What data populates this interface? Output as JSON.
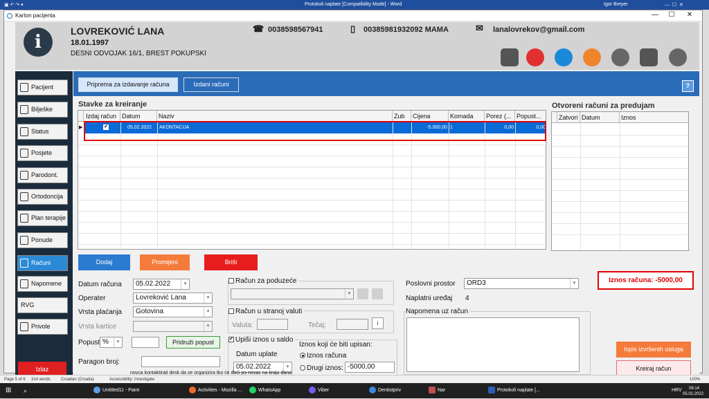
{
  "word": {
    "title": "Protokoli naplate [Compatibility Mode] - Word",
    "user": "Igor Breyer",
    "status_page": "Page 5 of 6",
    "status_words": "314 words",
    "status_lang": "Croatian (Croatia)",
    "status_access": "Accessibility: Investigate",
    "zoom": "100%",
    "doc_text": "novca kontaktirati desk da se organizira tko će doći po novac na kraju dana."
  },
  "window": {
    "title": "Karton pacijenta",
    "min": "—",
    "max": "☐",
    "close": "✕"
  },
  "header": {
    "icon": "i",
    "name": "LOVREKOVIĆ LANA",
    "dob": "18.01.1997",
    "address": "DESNI ODVOJAK 16/1, BREST POKUPSKI",
    "phone": "0038598567941",
    "mobile": "00385981932092 MAMA",
    "email": "lanalovrekov@gmail.com",
    "phone_icon": "☎",
    "mobile_icon": "▯",
    "email_icon": "✉"
  },
  "sidebar": {
    "items": [
      {
        "label": "Pacijent"
      },
      {
        "label": "Bilješke"
      },
      {
        "label": "Status"
      },
      {
        "label": "Posjete"
      },
      {
        "label": "Parodont."
      },
      {
        "label": "Ortodoncija"
      },
      {
        "label": "Plan terapije"
      },
      {
        "label": "Ponude"
      },
      {
        "label": "Računi"
      },
      {
        "label": "Napomene"
      },
      {
        "label": "RVG"
      },
      {
        "label": "Privole"
      }
    ],
    "exit": "Izlaz"
  },
  "tabs": {
    "prepare": "Priprema za izdavanje računa",
    "issued": "Izdani računi",
    "help": "?"
  },
  "items_grid": {
    "title": "Stavke za kreiranje",
    "columns": [
      "Izdaj račun",
      "Datum",
      "Naziv",
      "Zub",
      "Cijena",
      "Komada",
      "Porez (...",
      "Popust..."
    ],
    "row": {
      "check": "✔",
      "date": "05.02.2022",
      "name": "AKONTACIJA",
      "tooth": "",
      "price": "-5.000,00",
      "qty": "1",
      "tax": "0,00",
      "discount": "0,00"
    },
    "row_marker": "▶"
  },
  "open_grid": {
    "title": "Otvoreni računi za predujam",
    "columns": [
      "Zatvori",
      "Datum",
      "Iznos"
    ]
  },
  "actions": {
    "add": "Dodaj",
    "change": "Promijeni",
    "delete": "Briši"
  },
  "form": {
    "date_label": "Datum računa",
    "date_value": "05.02.2022",
    "operator_label": "Operater",
    "operator_value": "Lovreković Lana",
    "pay_label": "Vrsta plaćanja",
    "pay_value": "Gotovina",
    "card_label": "Vrsta kartice",
    "card_value": "",
    "discount_label": "Popust",
    "discount_unit": "%",
    "discount_value": "",
    "attach_discount": "Pridruži popust",
    "receipt_label": "Paragon broj:",
    "receipt_value": ""
  },
  "company": {
    "label": "Račun za poduzeće",
    "value": ""
  },
  "foreign": {
    "label": "Račun u stranoj valuti",
    "currency_label": "Valuta:",
    "rate_label": "Tečaj:",
    "info_btn": "i"
  },
  "balance": {
    "label": "Upiši iznos u saldo",
    "check": "✔",
    "payment_date_label": "Datum uplate",
    "payment_date": "05.02.2022",
    "amount_title": "Iznos koji će biti upisan:",
    "opt_invoice": "Iznos računa",
    "opt_other": "Drugi iznos:",
    "other_value": "-5000,00"
  },
  "business": {
    "space_label": "Poslovni prostor",
    "space_value": "ORD3",
    "device_label": "Naplatni uređaj",
    "device_value": "4"
  },
  "note": {
    "label": "Napomena uz račun",
    "value": ""
  },
  "total": {
    "text": "Iznos računa: -5000,00"
  },
  "buttons": {
    "print": "Ispis izvršenih usluga",
    "create": "Kreiraj račun"
  },
  "taskbar": {
    "apps": [
      "Untitled11 - Paint",
      "Activities - Mozilla ...",
      "WhatsApp",
      "Viber",
      "Dentistpriv",
      "Nar",
      "Protokoli naplate [..."
    ],
    "lang": "HRV",
    "time": "08:14",
    "date": "05.02.2022"
  },
  "colors": {
    "accent": "#2b6cb8",
    "danger": "#e00000",
    "add": "#2b7bd0",
    "change": "#f47b3a",
    "delete": "#e81c1c",
    "sidebar": "#1a2c3c"
  }
}
